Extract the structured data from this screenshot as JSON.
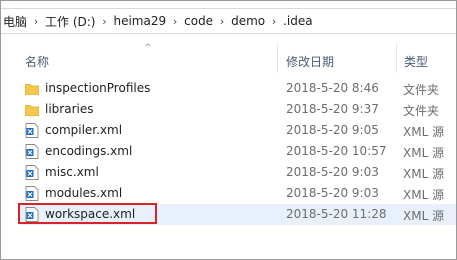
{
  "breadcrumb": {
    "items": [
      "电脑",
      "工作 (D:)",
      "heima29",
      "code",
      "demo",
      ".idea"
    ]
  },
  "columns": {
    "name": "名称",
    "date": "修改日期",
    "type": "类型"
  },
  "files": [
    {
      "name": "inspectionProfiles",
      "date": "2018-5-20 8:46",
      "type": "文件夹",
      "icon": "folder-icon"
    },
    {
      "name": "libraries",
      "date": "2018-5-20 9:37",
      "type": "文件夹",
      "icon": "folder-icon"
    },
    {
      "name": "compiler.xml",
      "date": "2018-5-20 9:05",
      "type": "XML 源",
      "icon": "xml-file-icon"
    },
    {
      "name": "encodings.xml",
      "date": "2018-5-20 10:57",
      "type": "XML 源",
      "icon": "xml-file-icon"
    },
    {
      "name": "misc.xml",
      "date": "2018-5-20 9:03",
      "type": "XML 源",
      "icon": "xml-file-icon"
    },
    {
      "name": "modules.xml",
      "date": "2018-5-20 9:03",
      "type": "XML 源",
      "icon": "xml-file-icon"
    },
    {
      "name": "workspace.xml",
      "date": "2018-5-20 11:28",
      "type": "XML 源",
      "icon": "xml-file-icon"
    }
  ],
  "colors": {
    "highlight_border": "#d7232b",
    "selected_row": "#e8f1fb",
    "header_text": "#4b5b76",
    "folder": "#f5c750"
  }
}
